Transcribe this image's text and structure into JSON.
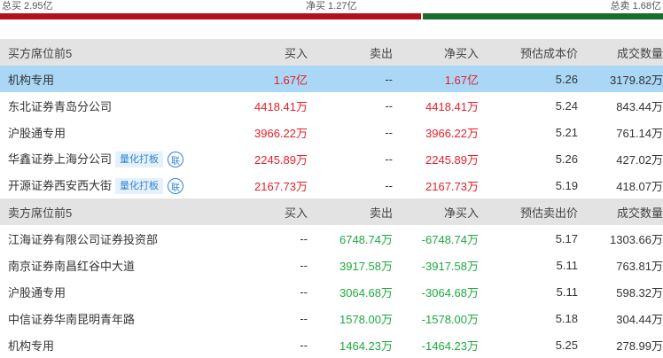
{
  "summary": {
    "total_buy": "总买 2.95亿",
    "net_buy": "净买 1.27亿",
    "total_sell": "总卖 1.68亿"
  },
  "buy_section": {
    "headers": [
      "买方席位前5",
      "买入",
      "卖出",
      "净买入",
      "预估成本价",
      "成交数量"
    ],
    "rows": [
      [
        "机构专用",
        "1.67亿",
        "--",
        "1.67亿",
        "5.26",
        "3179.82万"
      ],
      [
        "东北证券青岛分公司",
        "4418.41万",
        "--",
        "4418.41万",
        "5.24",
        "843.44万"
      ],
      [
        "沪股通专用",
        "3966.22万",
        "--",
        "3966.22万",
        "5.21",
        "761.14万"
      ],
      [
        "华鑫证券上海分公司",
        "2245.89万",
        "--",
        "2245.89万",
        "5.26",
        "427.02万"
      ],
      [
        "开源证券西安西大街",
        "2167.73万",
        "--",
        "2167.73万",
        "5.19",
        "418.07万"
      ]
    ],
    "tags": {
      "quant": "量化打板",
      "lian": "联"
    }
  },
  "sell_section": {
    "headers": [
      "卖方席位前5",
      "买入",
      "卖出",
      "净买入",
      "预估卖出价",
      "成交数量"
    ],
    "rows": [
      [
        "江海证券有限公司证券投资部",
        "--",
        "6748.74万",
        "-6748.74万",
        "5.17",
        "1303.66万"
      ],
      [
        "南京证券南昌红谷中大道",
        "--",
        "3917.58万",
        "-3917.58万",
        "5.11",
        "763.81万"
      ],
      [
        "沪股通专用",
        "--",
        "3064.68万",
        "-3064.68万",
        "5.11",
        "598.32万"
      ],
      [
        "中信证券华南昆明青年路",
        "--",
        "1578.00万",
        "-1578.00万",
        "5.18",
        "304.44万"
      ],
      [
        "机构专用",
        "--",
        "1464.23万",
        "-1464.23万",
        "5.25",
        "278.99万"
      ]
    ]
  },
  "bar": {
    "buy_share": 0.637,
    "sell_share": 0.363,
    "buy_color": "#b5101d",
    "sell_color": "#1a6e2c"
  }
}
